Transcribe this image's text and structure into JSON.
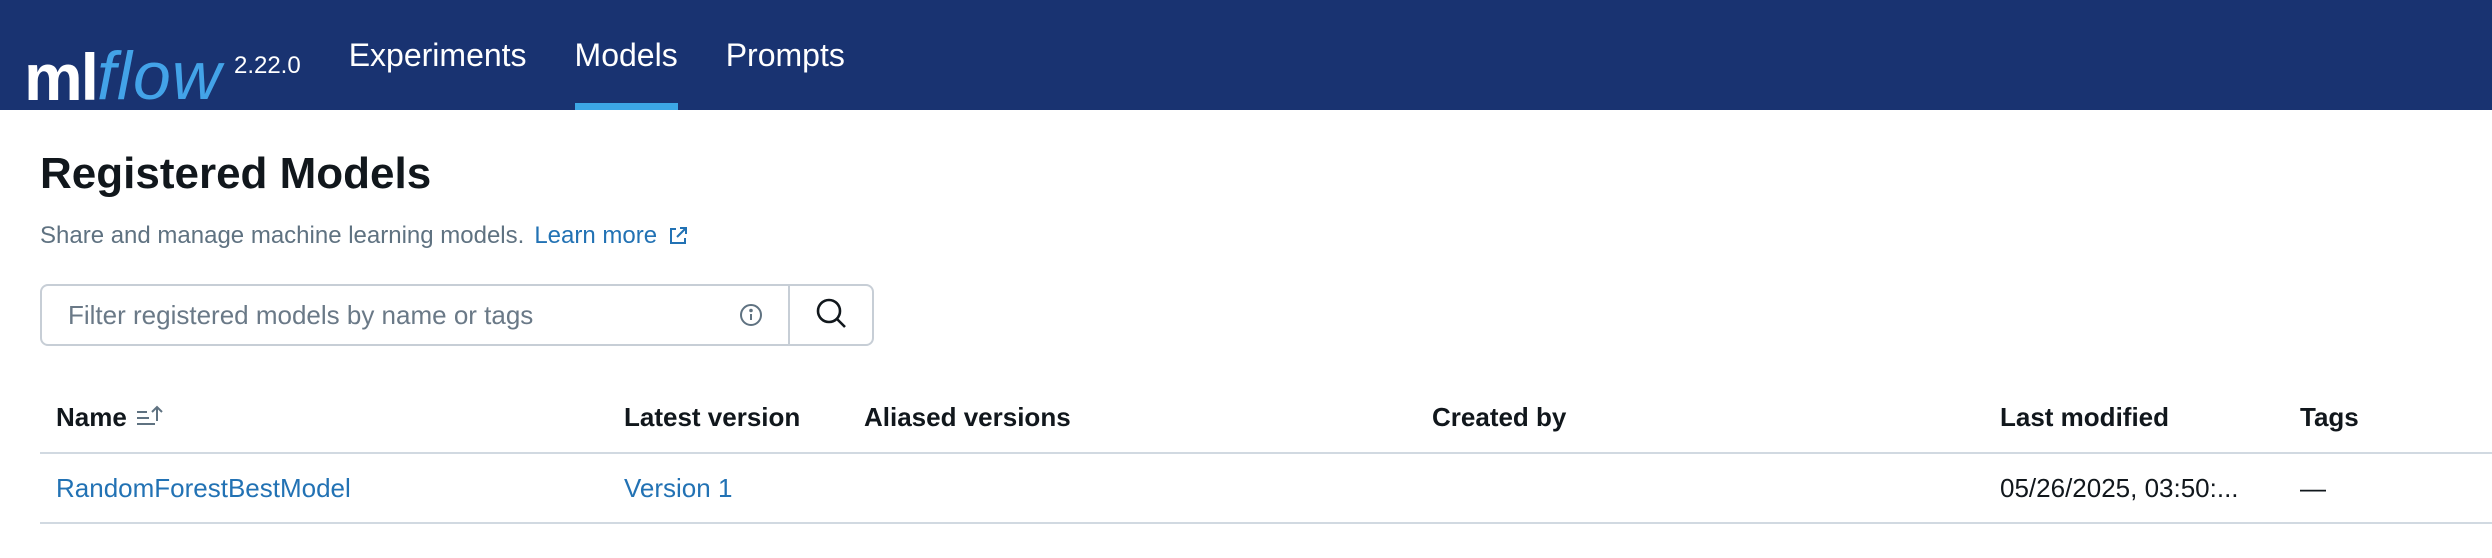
{
  "app": {
    "logo_ml": "ml",
    "logo_flow": "flow",
    "version": "2.22.0"
  },
  "nav": {
    "items": [
      {
        "label": "Experiments",
        "active": false
      },
      {
        "label": "Models",
        "active": true
      },
      {
        "label": "Prompts",
        "active": false
      }
    ]
  },
  "page": {
    "title": "Registered Models",
    "subtitle": "Share and manage machine learning models.",
    "learn_more": "Learn more"
  },
  "search": {
    "placeholder": "Filter registered models by name or tags",
    "value": ""
  },
  "table": {
    "columns": [
      "Name",
      "Latest version",
      "Aliased versions",
      "Created by",
      "Last modified",
      "Tags"
    ],
    "rows": [
      {
        "name": "RandomForestBestModel",
        "latest_version": "Version 1",
        "aliased_versions": "",
        "created_by": "",
        "last_modified": "05/26/2025, 03:50:...",
        "tags": "—"
      }
    ]
  },
  "colors": {
    "topbar": "#193371",
    "accent": "#3ca7e6",
    "link": "#2272b4"
  }
}
